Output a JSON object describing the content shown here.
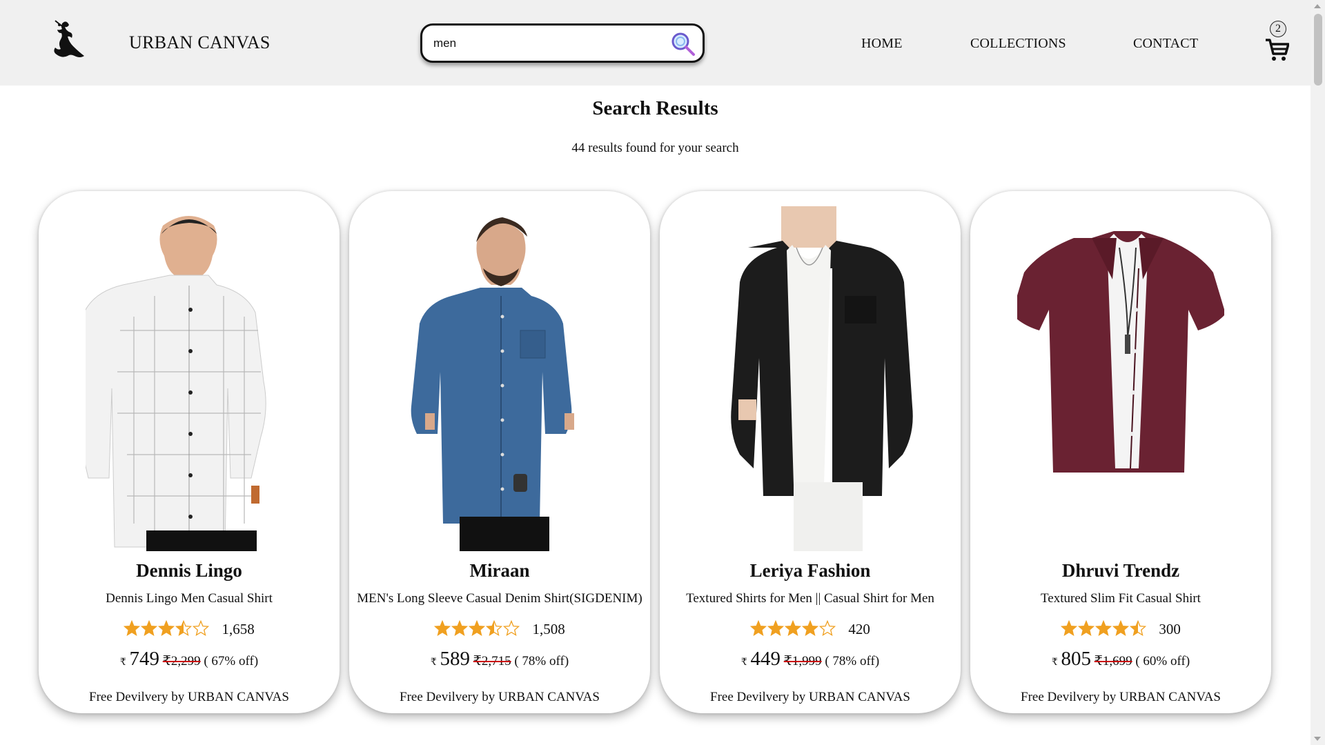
{
  "header": {
    "brand": "URBAN CANVAS",
    "search": {
      "value": "men",
      "placeholder": ""
    },
    "nav": [
      "HOME",
      "COLLECTIONS",
      "CONTACT"
    ],
    "cart_count": "2"
  },
  "results": {
    "title": "Search Results",
    "count_text": "44 results found for your search"
  },
  "products": [
    {
      "brand": "Dennis Lingo",
      "description": "Dennis Lingo Men Casual Shirt",
      "rating": 3.5,
      "reviews": "1,658",
      "currency": "₹",
      "price": "749",
      "mrp": "2,299",
      "discount": "( 67% off)",
      "delivery": "Free Devilvery by URBAN CANVAS",
      "image": "white-checked-shirt"
    },
    {
      "brand": "Miraan",
      "description": "MEN's Long Sleeve Casual Denim Shirt(SIGDENIM)",
      "rating": 3.5,
      "reviews": "1,508",
      "currency": "₹",
      "price": "589",
      "mrp": "2,715",
      "discount": "( 78% off)",
      "delivery": "Free Devilvery by URBAN CANVAS",
      "image": "blue-denim-shirt"
    },
    {
      "brand": "Leriya Fashion",
      "description": "Textured Shirts for Men || Casual Shirt for Men",
      "rating": 4,
      "reviews": "420",
      "currency": "₹",
      "price": "449",
      "mrp": "1,999",
      "discount": "( 78% off)",
      "delivery": "Free Devilvery by URBAN CANVAS",
      "image": "black-textured-shirt"
    },
    {
      "brand": "Dhruvi Trendz",
      "description": "Textured Slim Fit Casual Shirt",
      "rating": 4.5,
      "reviews": "300",
      "currency": "₹",
      "price": "805",
      "mrp": "1,699",
      "discount": "( 60% off)",
      "delivery": "Free Devilvery by URBAN CANVAS",
      "image": "maroon-shirt"
    }
  ],
  "colors": {
    "header_bg": "#f0f0f0",
    "star": "#f0a020",
    "strike": "#cc0000",
    "white_shirt": "#f2f2f2",
    "denim": "#3d6a9c",
    "black_shirt": "#1c1c1c",
    "maroon": "#6a2232"
  }
}
